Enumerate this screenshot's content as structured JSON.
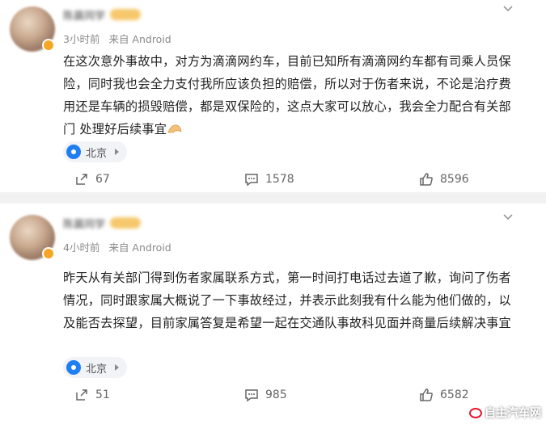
{
  "posts": [
    {
      "username": "陈晨同学",
      "time": "3小时前",
      "source": "来自 Android",
      "content_lines": [
        "在这次意外事故中，对方为滴滴网约车，目前已知所有滴滴网约车都有司乘人员保",
        "险，同时我也会全力支付我所应该负担的赔偿，所以对于伤者来说，不论是治疗费",
        "用还是车辆的损毁赔偿，都是双保险的，这点大家可以放心，我会全力配合有关部",
        "门 处理好后续事宜"
      ],
      "trailing_emoji": "praying-hands",
      "location": "北京",
      "reposts": "67",
      "comments": "1578",
      "likes": "8596"
    },
    {
      "username": "陈晨同学",
      "time": "4小时前",
      "source": "来自 Android",
      "content_lines": [
        "昨天从有关部门得到伤者家属联系方式，第一时间打电话过去道了歉，询问了伤者",
        "情况，同时跟家属大概说了一下事故经过，并表示此刻我有什么能为他们做的，以",
        "及能否去探望，目前家属答复是希望一起在交通队事故科见面并商量后续解决事宜"
      ],
      "location": "北京",
      "reposts": "51",
      "comments": "985",
      "likes": "6582"
    }
  ],
  "watermark": "自主汽车网",
  "colors": {
    "accent": "#1f7ef4",
    "badge": "#f5a623",
    "divider": "#f2f2f2"
  },
  "icons": [
    "more-chevron-icon",
    "location-pin-icon",
    "repost-icon",
    "comment-icon",
    "like-icon"
  ]
}
